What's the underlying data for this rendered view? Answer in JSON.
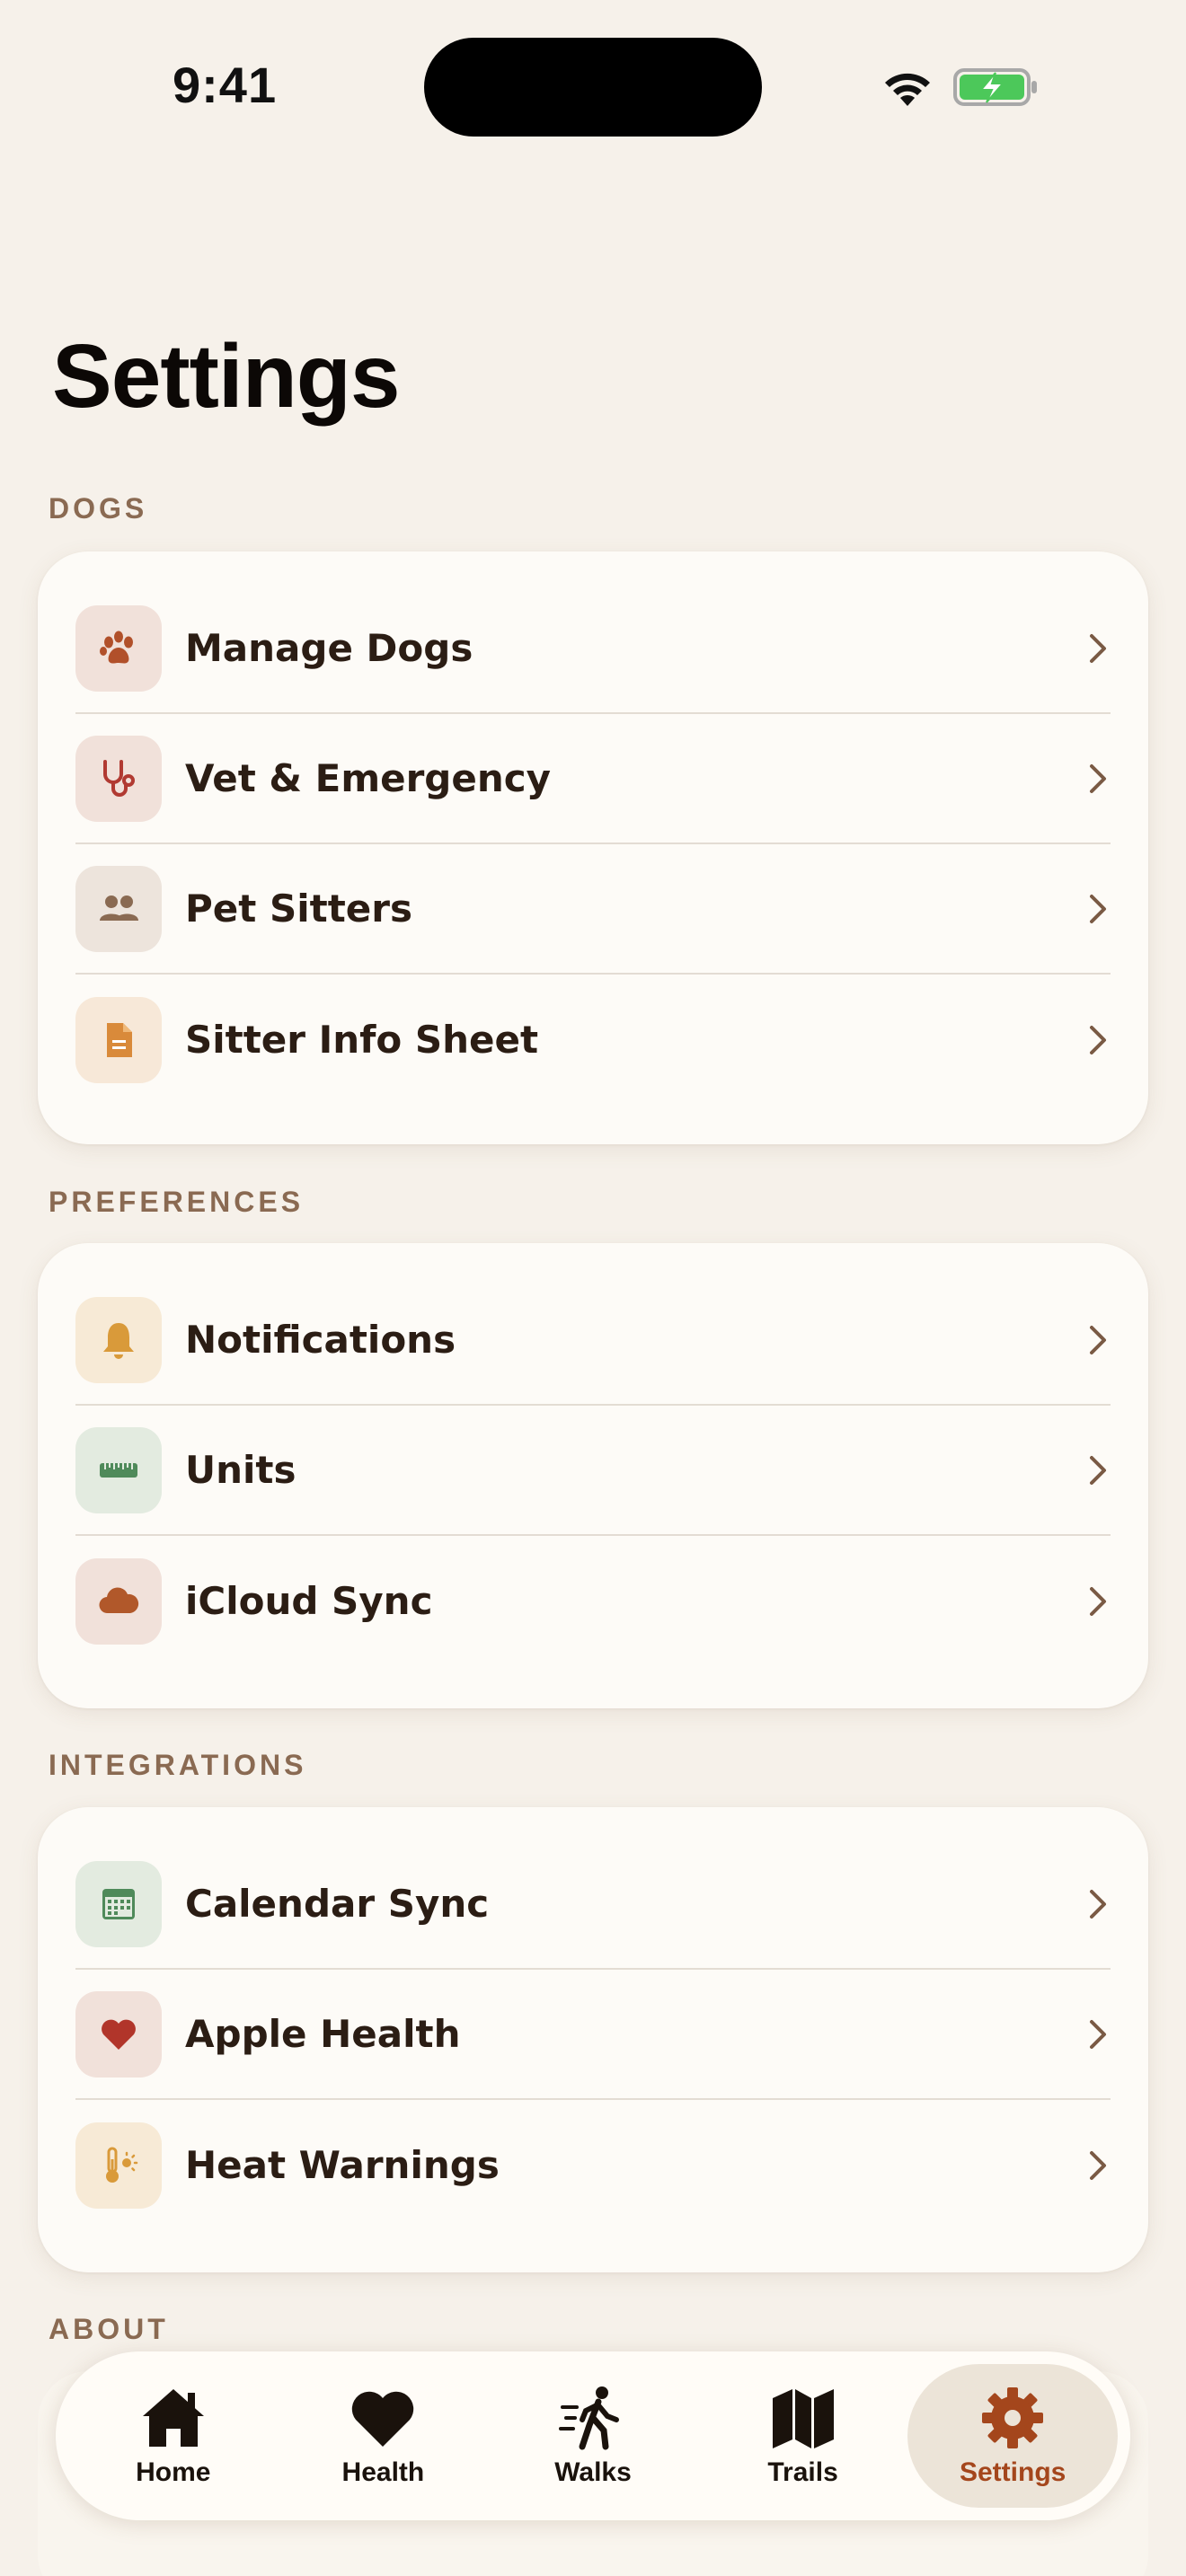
{
  "status_bar": {
    "time": "9:41"
  },
  "page": {
    "title": "Settings"
  },
  "colors": {
    "background": "#f6f1ea",
    "card": "#fdfbf7",
    "accent": "#a4461c",
    "section_label": "#8a6a52"
  },
  "sections": [
    {
      "label": "DOGS",
      "items": [
        {
          "label": "Manage Dogs",
          "icon": "paw-icon"
        },
        {
          "label": "Vet & Emergency",
          "icon": "stethoscope-icon"
        },
        {
          "label": "Pet Sitters",
          "icon": "people-icon"
        },
        {
          "label": "Sitter Info Sheet",
          "icon": "document-icon"
        }
      ]
    },
    {
      "label": "PREFERENCES",
      "items": [
        {
          "label": "Notifications",
          "icon": "bell-icon"
        },
        {
          "label": "Units",
          "icon": "ruler-icon"
        },
        {
          "label": "iCloud Sync",
          "icon": "cloud-icon"
        }
      ]
    },
    {
      "label": "INTEGRATIONS",
      "items": [
        {
          "label": "Calendar Sync",
          "icon": "calendar-icon"
        },
        {
          "label": "Apple Health",
          "icon": "heart-icon"
        },
        {
          "label": "Heat Warnings",
          "icon": "thermometer-sun-icon"
        }
      ]
    },
    {
      "label": "ABOUT",
      "items": []
    }
  ],
  "tab_bar": {
    "tabs": [
      {
        "label": "Home",
        "icon": "house-icon",
        "active": false
      },
      {
        "label": "Health",
        "icon": "heart-icon",
        "active": false
      },
      {
        "label": "Walks",
        "icon": "walking-person-icon",
        "active": false
      },
      {
        "label": "Trails",
        "icon": "map-icon",
        "active": false
      },
      {
        "label": "Settings",
        "icon": "gear-icon",
        "active": true
      }
    ]
  }
}
